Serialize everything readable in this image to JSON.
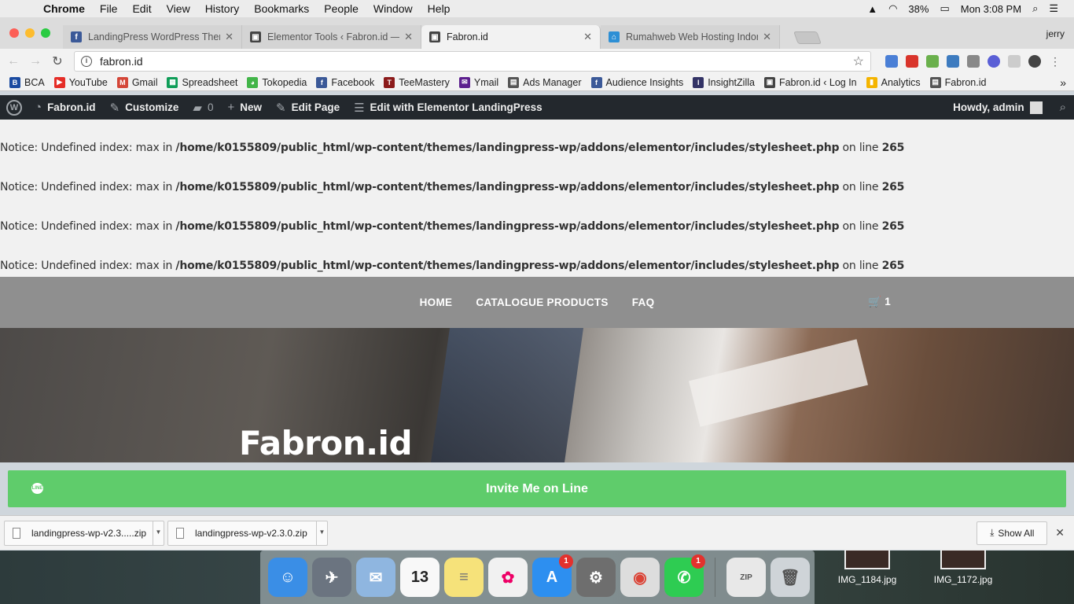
{
  "menubar": {
    "app": "Chrome",
    "items": [
      "File",
      "Edit",
      "View",
      "History",
      "Bookmarks",
      "People",
      "Window",
      "Help"
    ],
    "battery": "38%",
    "clock": "Mon 3:08 PM"
  },
  "tabs": [
    {
      "label": "LandingPress WordPress Ther",
      "favicon": "facebook-icon",
      "color": "#3b5998"
    },
    {
      "label": "Elementor Tools ‹ Fabron.id —",
      "favicon": "site-icon",
      "color": "#444444"
    },
    {
      "label": "Fabron.id",
      "favicon": "site-icon",
      "color": "#444444"
    },
    {
      "label": "Rumahweb Web Hosting Indon",
      "favicon": "rumahweb-icon",
      "color": "#2d8fd5"
    }
  ],
  "profile": "jerry",
  "omnibox": {
    "url": "fabron.id"
  },
  "bookmarks": [
    {
      "label": "BCA",
      "color": "#1a4aa0"
    },
    {
      "label": "YouTube",
      "color": "#e52d27"
    },
    {
      "label": "Gmail",
      "color": "#d44638"
    },
    {
      "label": "Spreadsheet",
      "color": "#0f9d58"
    },
    {
      "label": "Tokopedia",
      "color": "#42b549"
    },
    {
      "label": "Facebook",
      "color": "#3b5998"
    },
    {
      "label": "TeeMastery",
      "color": "#8b1a1a"
    },
    {
      "label": "Ymail",
      "color": "#5c1e8e"
    },
    {
      "label": "Ads Manager",
      "color": "#555555"
    },
    {
      "label": "Audience Insights",
      "color": "#3b5998"
    },
    {
      "label": "InsightZilla",
      "color": "#333366"
    },
    {
      "label": "Fabron.id ‹ Log In",
      "color": "#444444"
    },
    {
      "label": "Analytics",
      "color": "#f4b400"
    },
    {
      "label": "Fabron.id",
      "color": "#555555"
    }
  ],
  "adminbar": {
    "site": "Fabron.id",
    "customize": "Customize",
    "comments": "0",
    "new": "New",
    "edit_page": "Edit Page",
    "elementor": "Edit with Elementor LandingPress",
    "howdy": "Howdy, admin"
  },
  "notices": [
    {
      "prefix": "Notice",
      "msg": ": Undefined index: max in ",
      "path": "/home/k0155809/public_html/wp-content/themes/landingpress-wp/addons/elementor/includes/stylesheet.php",
      "online": " on line ",
      "line": "265"
    },
    {
      "prefix": "Notice",
      "msg": ": Undefined index: max in ",
      "path": "/home/k0155809/public_html/wp-content/themes/landingpress-wp/addons/elementor/includes/stylesheet.php",
      "online": " on line ",
      "line": "265"
    },
    {
      "prefix": "Notice",
      "msg": ": Undefined index: max in ",
      "path": "/home/k0155809/public_html/wp-content/themes/landingpress-wp/addons/elementor/includes/stylesheet.php",
      "online": " on line ",
      "line": "265"
    },
    {
      "prefix": "Notice",
      "msg": ": Undefined index: max in ",
      "path": "/home/k0155809/public_html/wp-content/themes/landingpress-wp/addons/elementor/includes/stylesheet.php",
      "online": " on line ",
      "line": "265"
    }
  ],
  "sitenav": {
    "items": [
      "HOME",
      "CATALOGUE PRODUCTS",
      "FAQ"
    ],
    "cart_count": "1"
  },
  "hero": {
    "title": "Fabron.id"
  },
  "line_button": {
    "label": "Invite Me on Line",
    "color": "#5fcc6b"
  },
  "downloads": {
    "items": [
      "landingpress-wp-v2.3.....zip",
      "landingpress-wp-v2.3.0.zip"
    ],
    "show_all": "Show All"
  },
  "dock": {
    "apps": [
      {
        "name": "finder-icon",
        "color": "#3a8ee6",
        "glyph": "☺"
      },
      {
        "name": "launchpad-icon",
        "color": "#6b7480",
        "glyph": "✈"
      },
      {
        "name": "mail-icon",
        "color": "#8fb6e0",
        "glyph": "✉"
      },
      {
        "name": "calendar-icon",
        "color": "#f8f8f8",
        "glyph": "13"
      },
      {
        "name": "notes-icon",
        "color": "#f6e27a",
        "glyph": "≡"
      },
      {
        "name": "photos-icon",
        "color": "#f1f1f1",
        "glyph": "✿"
      },
      {
        "name": "appstore-icon",
        "color": "#2d8ff0",
        "glyph": "A",
        "badge": "1"
      },
      {
        "name": "system-preferences-icon",
        "color": "#6e6e6e",
        "glyph": "⚙"
      },
      {
        "name": "chrome-icon",
        "color": "#dddddd",
        "glyph": "◉"
      },
      {
        "name": "whatsapp-icon",
        "color": "#2ecc52",
        "glyph": "✆",
        "badge": "1"
      }
    ],
    "after_sep": [
      {
        "name": "archive-utility-icon",
        "color": "#e8e8e8",
        "glyph": "ZIP"
      },
      {
        "name": "trash-icon",
        "color": "#cfd4d8",
        "glyph": "🗑"
      }
    ]
  },
  "desktop_files": [
    "IMG_1184.jpg",
    "IMG_1172.jpg"
  ]
}
